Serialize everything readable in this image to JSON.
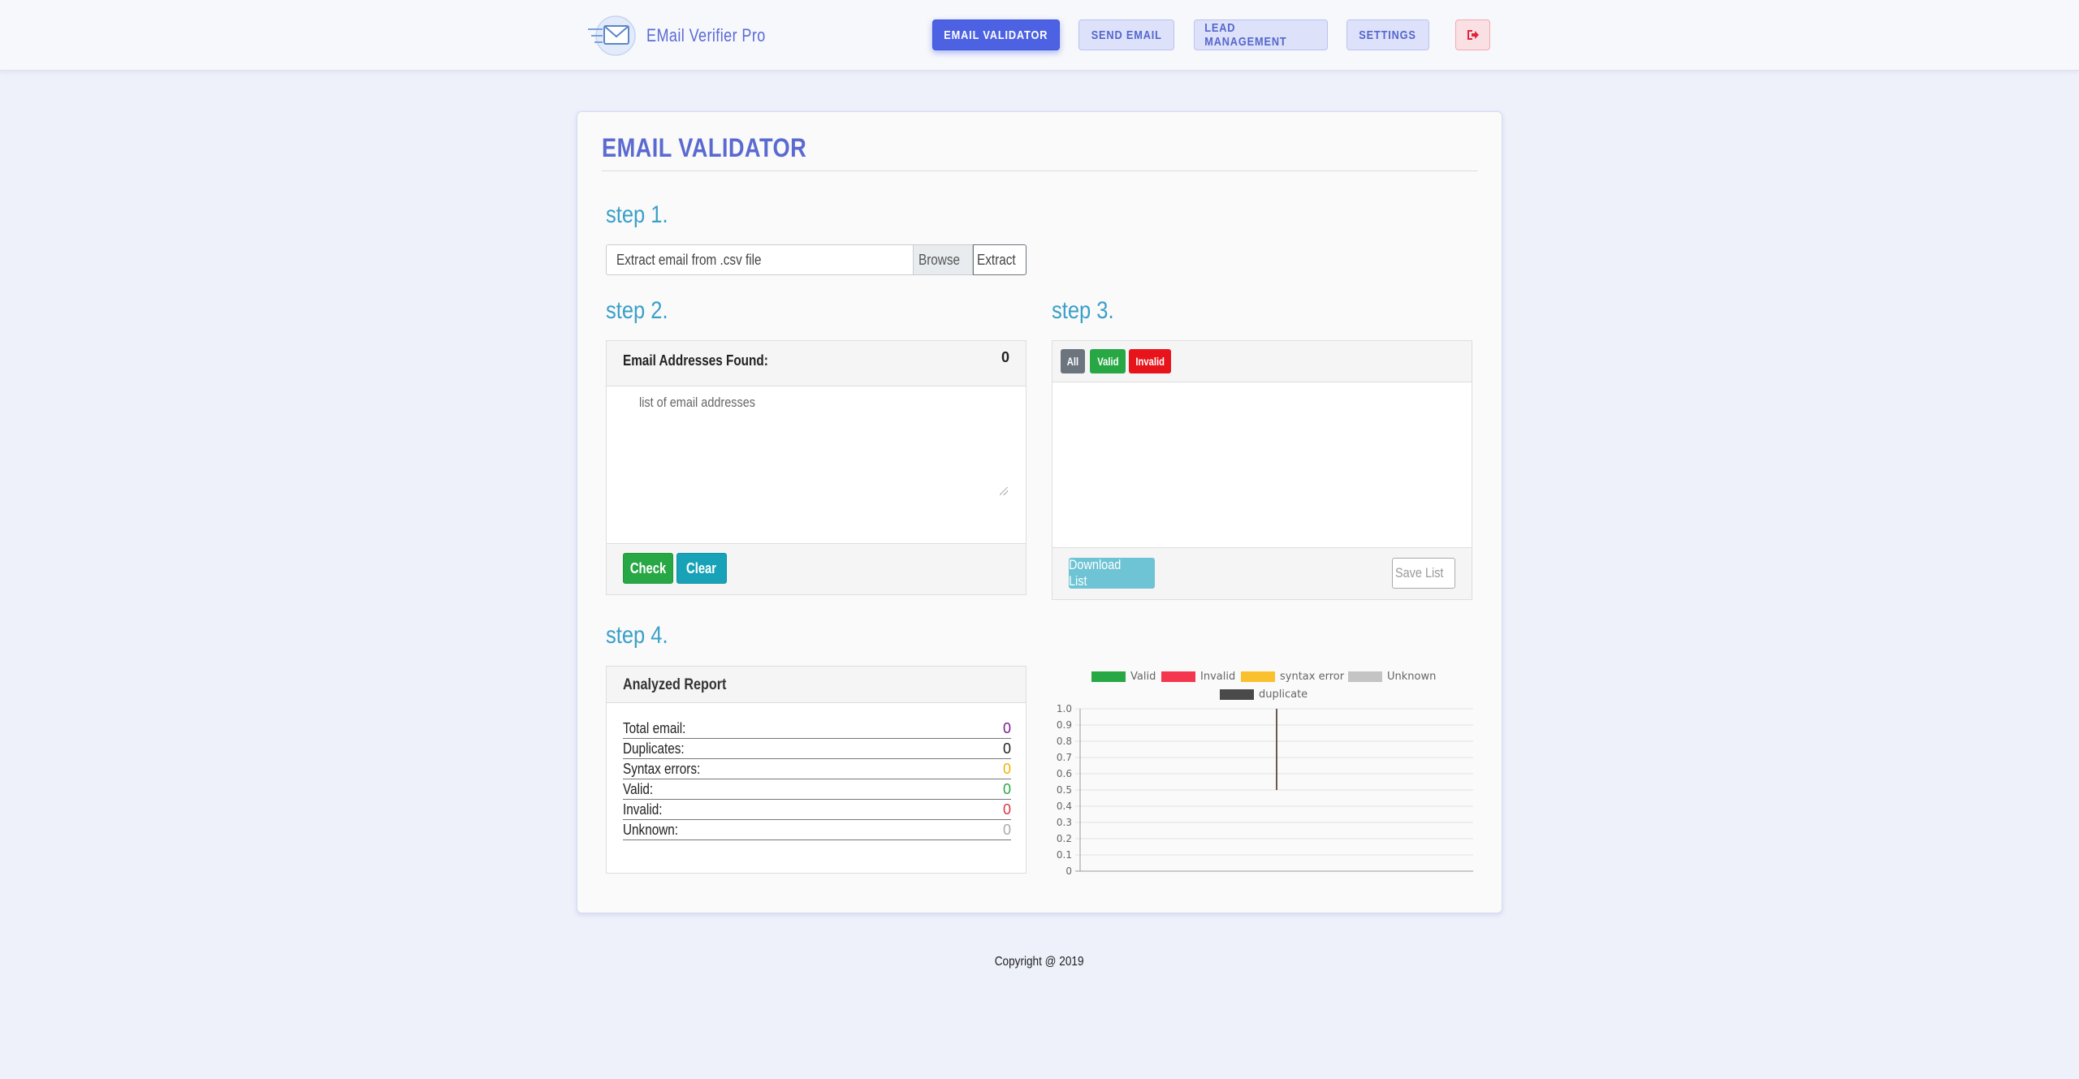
{
  "app": {
    "name": "EMail Verifier Pro"
  },
  "nav": {
    "items": [
      {
        "label": "EMAIL VALIDATOR",
        "active": true
      },
      {
        "label": "SEND EMAIL",
        "active": false
      },
      {
        "label": "LEAD MANAGEMENT",
        "active": false
      },
      {
        "label": "SETTINGS",
        "active": false
      }
    ],
    "logout_icon": "sign-out-icon"
  },
  "page": {
    "title": "EMAIL VALIDATOR"
  },
  "step1": {
    "label": "step 1.",
    "file_placeholder": "Extract email from .csv file",
    "browse_label": "Browse",
    "extract_label": "Extract"
  },
  "step2": {
    "label": "step 2.",
    "found_label": "Email Addresses Found:",
    "found_count": "0",
    "textarea_placeholder": "list of email addresses",
    "check_label": "Check",
    "clear_label": "Clear"
  },
  "step3": {
    "label": "step 3.",
    "filters": [
      {
        "label": "All",
        "color": "#6c757d"
      },
      {
        "label": "Valid",
        "color": "#28a745"
      },
      {
        "label": "Invalid",
        "color": "#e8141c"
      }
    ],
    "download_label": "Download List",
    "save_label": "Save List"
  },
  "step4": {
    "label": "step 4.",
    "report_title": "Analyzed Report",
    "rows": [
      {
        "label": "Total email:",
        "value": "0",
        "color": "#7b1e8f"
      },
      {
        "label": "Duplicates:",
        "value": "0",
        "color": "#222222"
      },
      {
        "label": "Syntax errors:",
        "value": "0",
        "color": "#f0b400"
      },
      {
        "label": "Valid:",
        "value": "0",
        "color": "#28a745"
      },
      {
        "label": "Invalid:",
        "value": "0",
        "color": "#dc3545"
      },
      {
        "label": "Unknown:",
        "value": "0",
        "color": "#aaaaaa"
      }
    ]
  },
  "chart_data": {
    "type": "bar",
    "legend": [
      {
        "name": "Valid",
        "color": "#28a745"
      },
      {
        "name": "Invalid",
        "color": "#f5364f"
      },
      {
        "name": "syntax error",
        "color": "#fbc02d"
      },
      {
        "name": "Unknown",
        "color": "#c4c4c4"
      },
      {
        "name": "duplicate",
        "color": "#4a4a4a"
      }
    ],
    "legend_placement": "top",
    "categories": [
      ""
    ],
    "series": [
      {
        "name": "Valid",
        "values": [
          0
        ]
      },
      {
        "name": "Invalid",
        "values": [
          0
        ]
      },
      {
        "name": "syntax error",
        "values": [
          0
        ]
      },
      {
        "name": "Unknown",
        "values": [
          0
        ]
      },
      {
        "name": "duplicate",
        "values": [
          0
        ]
      }
    ],
    "y_ticks": [
      "1.0",
      "0.9",
      "0.8",
      "0.7",
      "0.6",
      "0.5",
      "0.4",
      "0.3",
      "0.2",
      "0.1",
      "0"
    ],
    "ylim": [
      0,
      1
    ],
    "grid": true
  },
  "footer": {
    "text": "Copyright @ 2019"
  }
}
